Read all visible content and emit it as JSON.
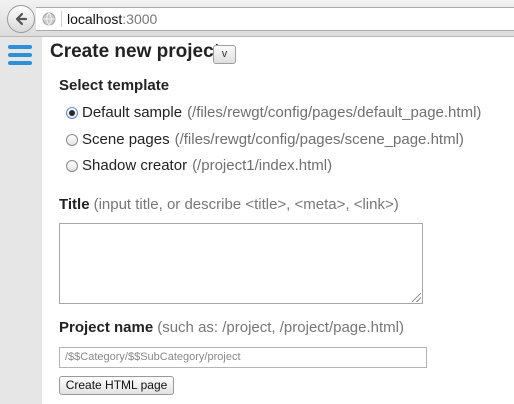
{
  "browser": {
    "url_host": "localhost",
    "url_port": ":3000"
  },
  "header": {
    "title": "Create new project",
    "toggle_label": "v"
  },
  "template": {
    "heading": "Select template",
    "options": [
      {
        "label": "Default sample",
        "path": "(/files/rewgt/config/pages/default_page.html)",
        "checked": true
      },
      {
        "label": "Scene pages",
        "path": "(/files/rewgt/config/pages/scene_page.html)",
        "checked": false
      },
      {
        "label": "Shadow creator",
        "path": "(/project1/index.html)",
        "checked": false
      }
    ]
  },
  "title_field": {
    "label": "Title",
    "hint": "(input title, or describe <title>, <meta>, <link>)",
    "value": ""
  },
  "project_name": {
    "label": "Project name",
    "hint": "(such as: /project, /project/page.html)",
    "value": "/$$Category/$$SubCategory/project"
  },
  "actions": {
    "create_label": "Create HTML page"
  },
  "colors": {
    "accent": "#2f8fd8",
    "rail": "#e6e6e6"
  }
}
